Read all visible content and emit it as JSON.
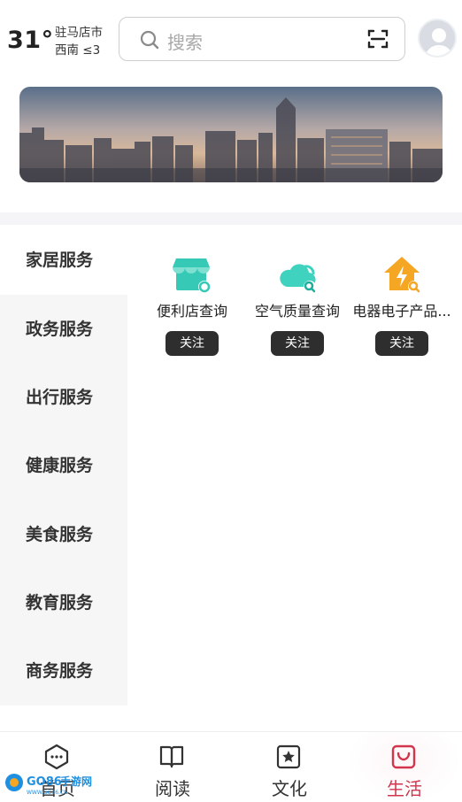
{
  "header": {
    "temperature": "31°",
    "city": "驻马店市",
    "wind": "西南  ≤3",
    "search_placeholder": "搜索"
  },
  "categories": [
    {
      "label": "家居服务",
      "active": true
    },
    {
      "label": "政务服务",
      "active": false
    },
    {
      "label": "出行服务",
      "active": false
    },
    {
      "label": "健康服务",
      "active": false
    },
    {
      "label": "美食服务",
      "active": false
    },
    {
      "label": "教育服务",
      "active": false
    },
    {
      "label": "商务服务",
      "active": false
    }
  ],
  "services": [
    {
      "name": "便利店查询",
      "follow": "关注",
      "icon": "store-icon",
      "color": "#35c9b6"
    },
    {
      "name": "空气质量查询",
      "follow": "关注",
      "icon": "cloud-search-icon",
      "color": "#3fd2bf"
    },
    {
      "name": "电器电子产品...",
      "follow": "关注",
      "icon": "home-power-icon",
      "color": "#f5a623"
    }
  ],
  "bottom_nav": [
    {
      "label": "首页",
      "icon": "home-chat-icon",
      "active": false
    },
    {
      "label": "阅读",
      "icon": "book-icon",
      "active": false
    },
    {
      "label": "文化",
      "icon": "star-box-icon",
      "active": false
    },
    {
      "label": "生活",
      "icon": "bag-icon",
      "active": true
    }
  ],
  "colors": {
    "accent": "#d2354b",
    "follow_button": "#2e2e2e",
    "sidebar_bg": "#f6f6f6"
  },
  "watermark": {
    "text": "GO86手游网",
    "url_text": "WWW.GO86.CN"
  }
}
